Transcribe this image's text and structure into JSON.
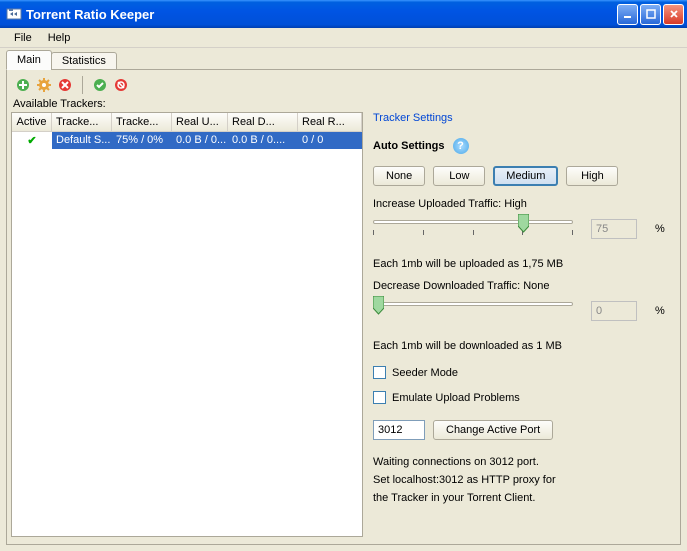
{
  "window": {
    "title": "Torrent Ratio Keeper"
  },
  "menu": {
    "file": "File",
    "help": "Help"
  },
  "tabs": {
    "main": "Main",
    "statistics": "Statistics"
  },
  "available_trackers_label": "Available Trackers:",
  "columns": {
    "active": "Active",
    "tracker": "Tracke...",
    "ratio": "Tracke...",
    "realu": "Real U...",
    "reald": "Real D...",
    "realr": "Real R..."
  },
  "rows": [
    {
      "active": "✔",
      "tracker": "Default S...",
      "ratio": "75% / 0%",
      "realu": "0.0 B / 0...",
      "reald": "0.0 B / 0....",
      "realr": "0 / 0"
    }
  ],
  "settings": {
    "title": "Tracker Settings",
    "auto_label": "Auto Settings",
    "buttons": {
      "none": "None",
      "low": "Low",
      "medium": "Medium",
      "high": "High"
    },
    "increase_label": "Increase Uploaded Traffic: High",
    "increase_pct": "75",
    "each_upload": "Each 1mb will be uploaded as 1,75 MB",
    "decrease_label": "Decrease Downloaded Traffic: None",
    "decrease_pct": "0",
    "each_download": "Each 1mb will be downloaded as 1 MB",
    "seeder_mode": "Seeder Mode",
    "emulate": "Emulate Upload Problems",
    "port": "3012",
    "change_port": "Change Active Port",
    "info1": "Waiting connections on 3012 port.",
    "info2": "Set localhost:3012 as HTTP proxy for",
    "info3": "the Tracker in your Torrent Client."
  },
  "pct_sign": "%"
}
